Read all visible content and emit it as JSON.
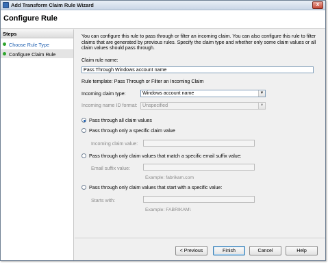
{
  "window": {
    "title": "Add Transform Claim Rule Wizard",
    "close_glyph": "X"
  },
  "header": {
    "title": "Configure Rule"
  },
  "steps": {
    "heading": "Steps",
    "items": [
      {
        "label": "Choose Rule Type",
        "state": "link"
      },
      {
        "label": "Configure Claim Rule",
        "state": "current"
      }
    ]
  },
  "main": {
    "description": "You can configure this rule to pass through or filter an incoming claim. You can also configure this rule to filter claims that are generated by previous rules. Specify the claim type and whether only some claim values or all claim values should pass through.",
    "claim_rule_name_label": "Claim rule name:",
    "claim_rule_name_value": "Pass Through Windows account name",
    "rule_template": "Rule template: Pass Through or Filter an Incoming Claim",
    "incoming_claim_type_label": "Incoming claim type:",
    "incoming_claim_type_value": "Windows account name",
    "incoming_name_id_format_label": "Incoming name ID format:",
    "incoming_name_id_format_value": "Unspecified",
    "options": [
      {
        "label": "Pass through all claim values",
        "checked": true
      },
      {
        "label": "Pass through only a specific claim value",
        "checked": false
      },
      {
        "label": "Pass through only claim values that match a specific email suffix value:",
        "checked": false
      },
      {
        "label": "Pass through only claim values that start with a specific value:",
        "checked": false
      }
    ],
    "incoming_claim_value_label": "Incoming claim value:",
    "email_suffix_label": "Email suffix value:",
    "email_example": "Example: fabrikam.com",
    "starts_with_label": "Starts with:",
    "starts_with_example": "Example: FABRIKAM\\"
  },
  "footer": {
    "previous": "< Previous",
    "finish": "Finish",
    "cancel": "Cancel",
    "help": "Help"
  },
  "icons": {
    "dropdown": "chevron-down-icon",
    "step_status": "green-dot-icon",
    "app": "wizard-icon"
  },
  "colors": {
    "link": "#2060b0",
    "step_dot": "#2ea52e",
    "disabled_text": "#8a8a8a"
  }
}
